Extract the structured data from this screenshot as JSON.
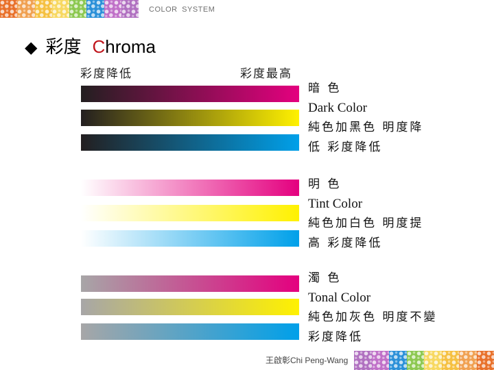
{
  "header": {
    "label": "COLOR  SYSTEM",
    "decorative_strip_colors": [
      "#e8702a",
      "#f0a050",
      "#f5c040",
      "#f7d860",
      "#8cc850",
      "#2a90d8",
      "#c070c8",
      "#b070c0"
    ]
  },
  "title": {
    "bullet_icon": "black-diamond",
    "bullet_glyph": "◆",
    "zh": "彩度",
    "en_first_letter": "C",
    "en_rest": "hroma",
    "accent_color": "#c0151c"
  },
  "scale": {
    "low_label": "彩度降低",
    "high_label": "彩度最高"
  },
  "groups": [
    {
      "id": "dark",
      "title_zh": "暗 色",
      "title_en": "Dark Color",
      "desc_line1": "純色加黑色 明度降",
      "desc_line2": "低 彩度降低",
      "bars": [
        {
          "name": "magenta",
          "from": "#231f20",
          "to": "#e4007f"
        },
        {
          "name": "yellow",
          "from": "#231f20",
          "to": "#fff100"
        },
        {
          "name": "cyan",
          "from": "#231f20",
          "to": "#00a0e9"
        }
      ]
    },
    {
      "id": "tint",
      "title_zh": "明 色",
      "title_en": "Tint Color",
      "desc_line1": "純色加白色 明度提",
      "desc_line2": "高 彩度降低",
      "bars": [
        {
          "name": "magenta",
          "from": "#ffffff",
          "to": "#e4007f"
        },
        {
          "name": "yellow",
          "from": "#ffffff",
          "to": "#fff100"
        },
        {
          "name": "cyan",
          "from": "#ffffff",
          "to": "#00a0e9"
        }
      ]
    },
    {
      "id": "tonal",
      "title_zh": "濁 色",
      "title_en": "Tonal Color",
      "desc_line1": "純色加灰色 明度不變",
      "desc_line2": "彩度降低",
      "bars": [
        {
          "name": "magenta",
          "from": "#a7a6a7",
          "to": "#e4007f"
        },
        {
          "name": "yellow",
          "from": "#a7a6a7",
          "to": "#fff100"
        },
        {
          "name": "cyan",
          "from": "#a7a6a7",
          "to": "#00a0e9"
        }
      ]
    }
  ],
  "footer": {
    "author": "王啟彰Chi Peng-Wang",
    "decorative_strip_colors": [
      "#b070c0",
      "#c070c8",
      "#2a90d8",
      "#8cc850",
      "#f7d860",
      "#f5c040",
      "#f0a050",
      "#e8702a"
    ]
  }
}
